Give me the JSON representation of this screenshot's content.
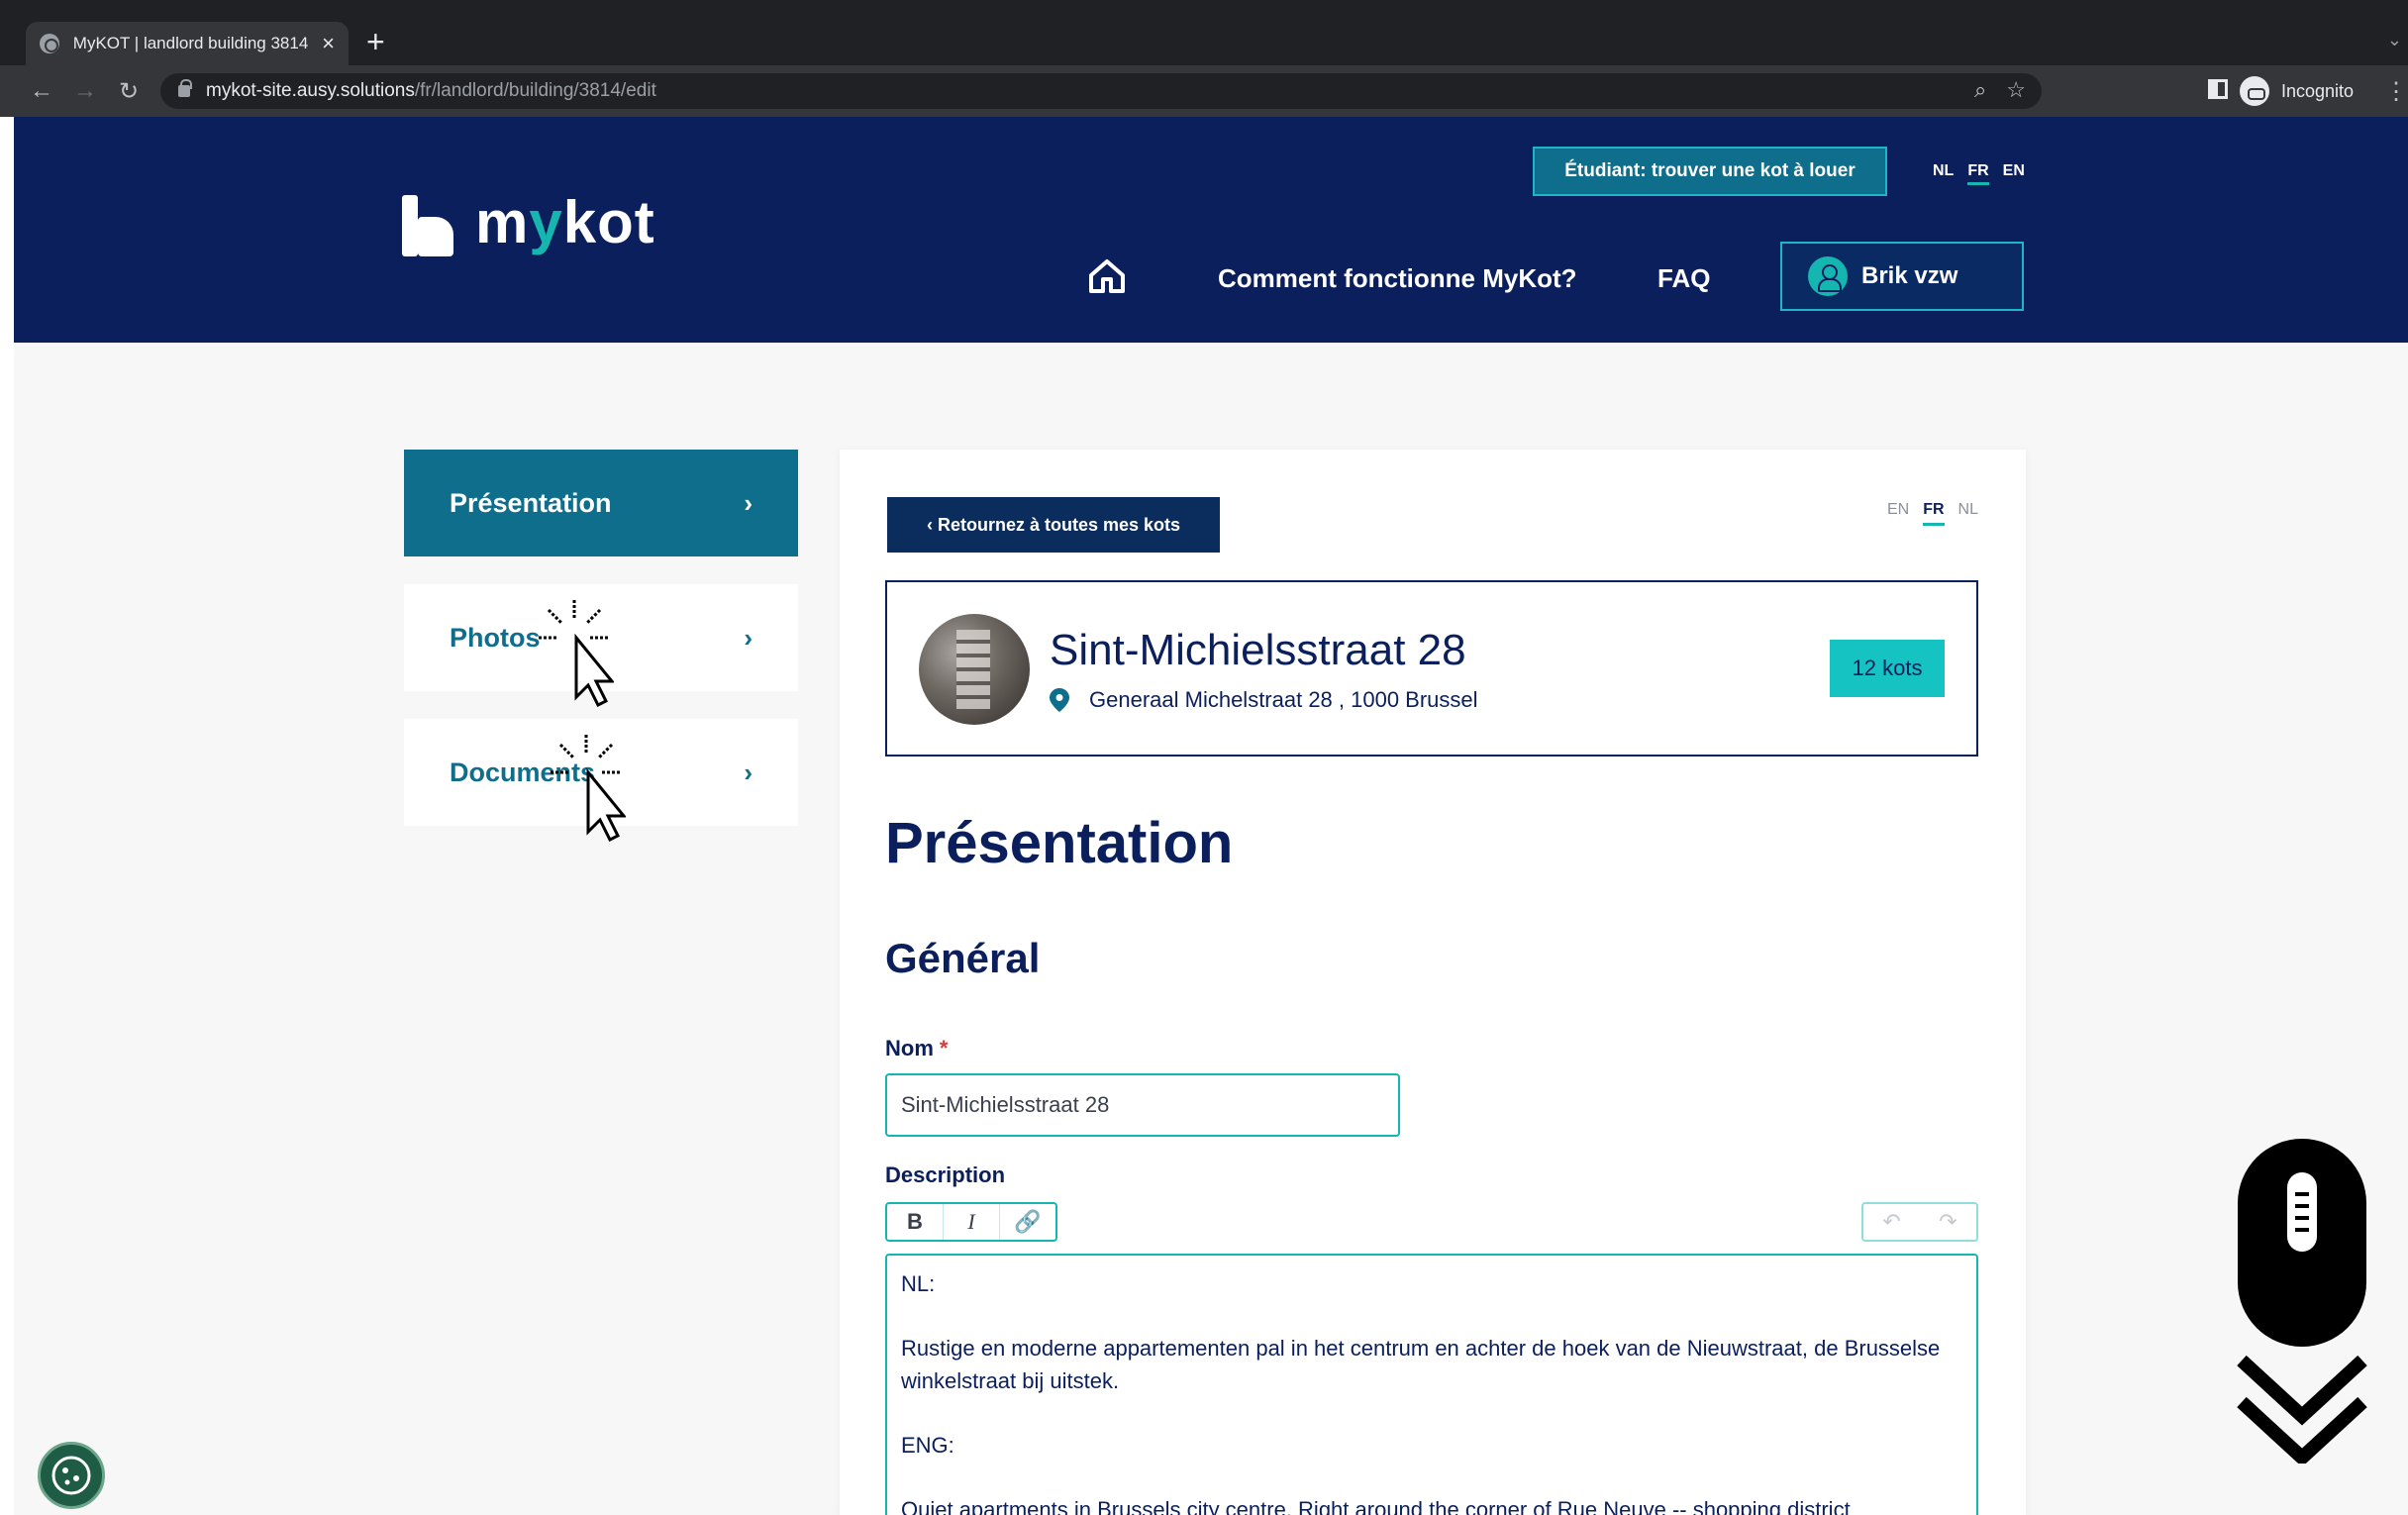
{
  "browser": {
    "tab_title": "MyKOT | landlord building 3814",
    "tab_close": "×",
    "new_tab": "+",
    "url_host": "mykot-site.ausy.solutions",
    "url_path": "/fr/landlord/building/3814/edit",
    "profile": "Incognito"
  },
  "header": {
    "logo_text_a": "m",
    "logo_text_accent": "y",
    "logo_text_b": "kot",
    "student_button": "Étudiant: trouver une kot à louer",
    "languages": [
      "NL",
      "FR",
      "EN"
    ],
    "active_language": "FR",
    "nav_how": "Comment fonctionne MyKot?",
    "nav_faq": "FAQ",
    "user_name": "Brik vzw"
  },
  "sidebar": {
    "items": [
      {
        "label": "Présentation",
        "chevron": "›"
      },
      {
        "label": "Photos",
        "chevron": "›"
      },
      {
        "label": "Documents",
        "chevron": "›"
      }
    ],
    "active_index": 0
  },
  "card": {
    "back_button": "‹  Retournez à toutes mes kots",
    "languages": [
      "EN",
      "FR",
      "NL"
    ],
    "active_language": "FR",
    "building": {
      "name": "Sint-Michielsstraat 28",
      "address": "Generaal Michelstraat 28 , 1000 Brussel",
      "kots_badge": "12 kots"
    },
    "section_title": "Présentation",
    "subsection_title": "Général",
    "name_label": "Nom",
    "required_mark": "*",
    "name_value": "Sint-Michielsstraat 28",
    "description_label": "Description",
    "toolbar": {
      "bold": "B",
      "italic": "I",
      "link": "🔗",
      "undo": "↶",
      "redo": "↷"
    },
    "description_lines": [
      "NL:",
      "Rustige en moderne appartementen pal in het centrum en achter de hoek van de Nieuwstraat, de Brusselse winkelstraat bij uitstek.",
      "ENG:",
      "Quiet apartments in Brussels city centre. Right around the corner of Rue Neuve -- shopping district"
    ]
  },
  "colors": {
    "header_bg": "#0b1f5c",
    "accent_teal": "#16b6b0",
    "sidebar_active": "#0f6e8c",
    "badge": "#16c3c3"
  }
}
